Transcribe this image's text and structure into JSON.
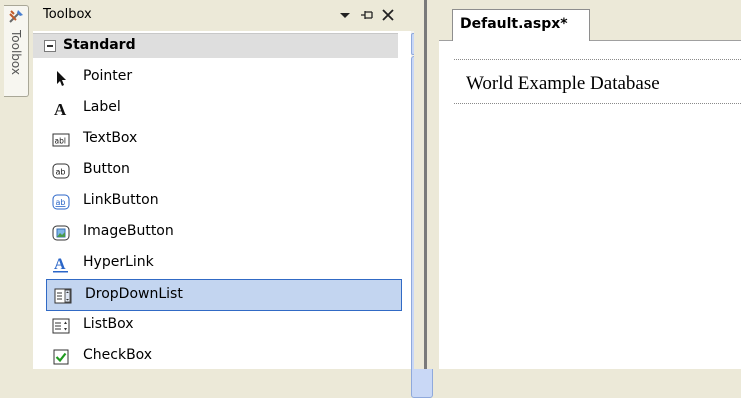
{
  "sidebar": {
    "tab_label": "Toolbox",
    "icon": "toolbox-icon"
  },
  "toolbox": {
    "title": "Toolbox",
    "controls": [
      "dropdown-arrow-icon",
      "pin-icon",
      "close-icon"
    ],
    "group": {
      "name": "Standard",
      "expanded": true
    },
    "items": [
      {
        "label": "Pointer",
        "icon": "pointer-icon"
      },
      {
        "label": "Label",
        "icon": "label-icon"
      },
      {
        "label": "TextBox",
        "icon": "textbox-icon"
      },
      {
        "label": "Button",
        "icon": "button-icon"
      },
      {
        "label": "LinkButton",
        "icon": "linkbutton-icon"
      },
      {
        "label": "ImageButton",
        "icon": "imagebutton-icon"
      },
      {
        "label": "HyperLink",
        "icon": "hyperlink-icon"
      },
      {
        "label": "DropDownList",
        "icon": "dropdownlist-icon",
        "selected": true
      },
      {
        "label": "ListBox",
        "icon": "listbox-icon"
      },
      {
        "label": "CheckBox",
        "icon": "checkbox-icon"
      }
    ]
  },
  "editor": {
    "tab_label": "Default.aspx*",
    "heading_text": "World Example Database"
  },
  "colors": {
    "selection_bg": "#c3d5f0",
    "selection_border": "#316ac5",
    "chrome": "#ece9d8"
  }
}
